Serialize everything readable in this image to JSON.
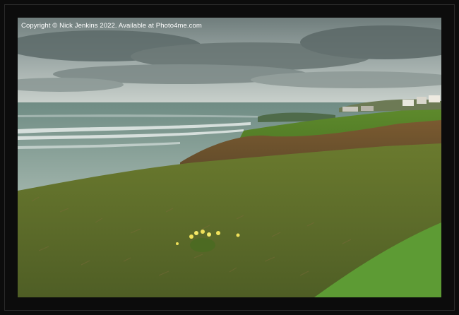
{
  "image": {
    "copyright": "Copyright © Nick Jenkins 2022. Available at Photo4me.com"
  }
}
